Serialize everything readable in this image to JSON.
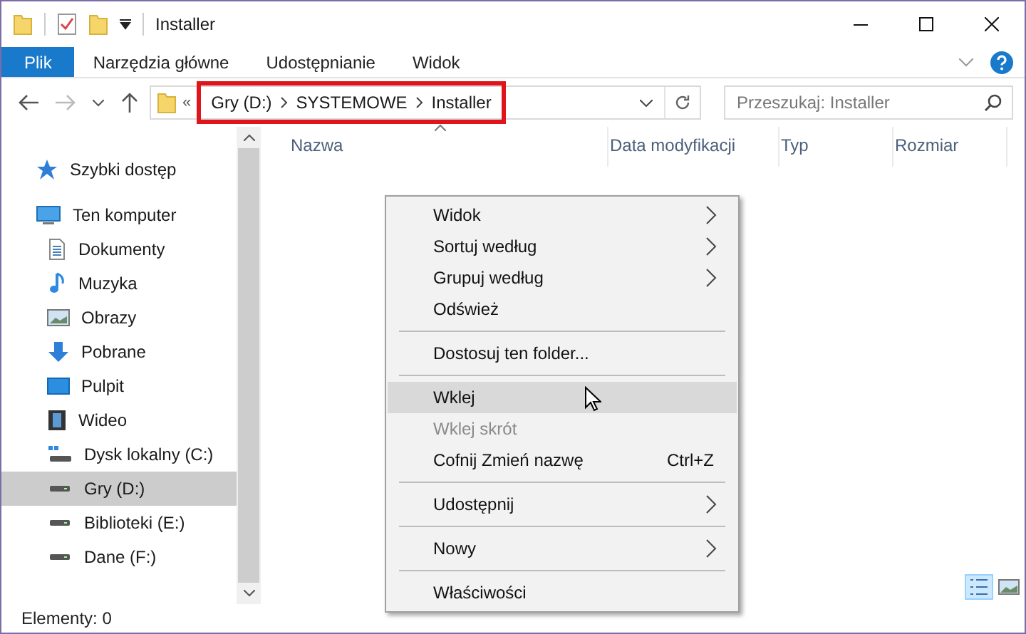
{
  "window": {
    "title": "Installer"
  },
  "ribbon_tabs": [
    {
      "label": "Plik",
      "kind": "file"
    },
    {
      "label": "Narzędzia główne",
      "kind": "tab"
    },
    {
      "label": "Udostępnianie",
      "kind": "tab"
    },
    {
      "label": "Widok",
      "kind": "tab"
    }
  ],
  "address_bar": {
    "overflow": "«",
    "highlighted": true,
    "crumbs": [
      "Gry (D:)",
      "SYSTEMOWE",
      "Installer"
    ]
  },
  "search": {
    "placeholder": "Przeszukaj: Installer"
  },
  "sidebar": {
    "items": [
      {
        "label": "Szybki dostęp",
        "selected": false
      },
      {
        "label": "Ten komputer",
        "selected": false,
        "children": [
          {
            "label": "Dokumenty",
            "selected": false
          },
          {
            "label": "Muzyka",
            "selected": false
          },
          {
            "label": "Obrazy",
            "selected": false
          },
          {
            "label": "Pobrane",
            "selected": false
          },
          {
            "label": "Pulpit",
            "selected": false
          },
          {
            "label": "Wideo",
            "selected": false
          },
          {
            "label": "Dysk lokalny (C:)",
            "selected": false
          },
          {
            "label": "Gry (D:)",
            "selected": true
          },
          {
            "label": "Biblioteki (E:)",
            "selected": false
          },
          {
            "label": "Dane (F:)",
            "selected": false
          }
        ]
      }
    ]
  },
  "table": {
    "columns": [
      "Nazwa",
      "Data modyfikacji",
      "Typ",
      "Rozmiar"
    ]
  },
  "context_menu": [
    {
      "kind": "item",
      "label": "Widok",
      "submenu": true,
      "disabled": false,
      "highlighted": false
    },
    {
      "kind": "item",
      "label": "Sortuj według",
      "submenu": true,
      "disabled": false,
      "highlighted": false
    },
    {
      "kind": "item",
      "label": "Grupuj według",
      "submenu": true,
      "disabled": false,
      "highlighted": false
    },
    {
      "kind": "item",
      "label": "Odśwież",
      "submenu": false,
      "disabled": false,
      "highlighted": false
    },
    {
      "kind": "separator"
    },
    {
      "kind": "item",
      "label": "Dostosuj ten folder...",
      "submenu": false,
      "disabled": false,
      "highlighted": false
    },
    {
      "kind": "separator"
    },
    {
      "kind": "item",
      "label": "Wklej",
      "submenu": false,
      "disabled": false,
      "highlighted": true
    },
    {
      "kind": "item",
      "label": "Wklej skrót",
      "submenu": false,
      "disabled": true,
      "highlighted": false
    },
    {
      "kind": "item",
      "label": "Cofnij Zmień nazwę",
      "shortcut": "Ctrl+Z",
      "submenu": false,
      "disabled": false,
      "highlighted": false
    },
    {
      "kind": "separator"
    },
    {
      "kind": "item",
      "label": "Udostępnij",
      "submenu": true,
      "disabled": false,
      "highlighted": false
    },
    {
      "kind": "separator"
    },
    {
      "kind": "item",
      "label": "Nowy",
      "submenu": true,
      "disabled": false,
      "highlighted": false
    },
    {
      "kind": "separator"
    },
    {
      "kind": "item",
      "label": "Właściwości",
      "submenu": false,
      "disabled": false,
      "highlighted": false
    }
  ],
  "status_bar": {
    "text": "Elementy: 0"
  }
}
